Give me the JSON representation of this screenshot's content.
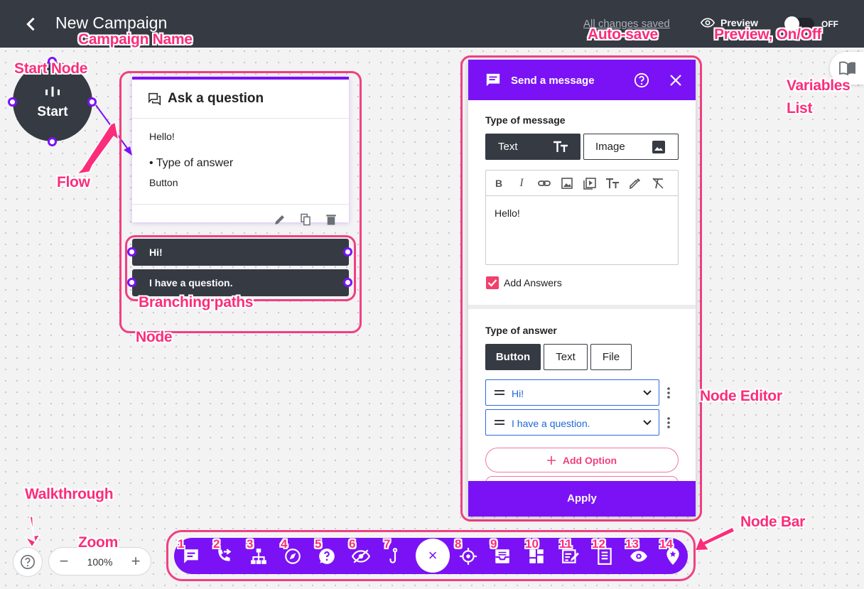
{
  "header": {
    "campaign_name": "New Campaign",
    "autosave_text": "All changes saved",
    "preview_label": "Preview",
    "toggle_state": "OFF"
  },
  "start_node": {
    "label": "Start"
  },
  "question_node": {
    "title": "Ask a question",
    "message": "Hello!",
    "type_of_answer": "• Type of answer",
    "answer_type": "Button",
    "branches": [
      "Hi!",
      "I have a question."
    ]
  },
  "editor": {
    "title": "Send a message",
    "type_of_message_label": "Type of message",
    "message_types": [
      "Text",
      "Image"
    ],
    "message_text": "Hello!",
    "add_answers_label": "Add Answers",
    "type_of_answer_label": "Type of answer",
    "answer_types": [
      "Button",
      "Text",
      "File"
    ],
    "answers": [
      "Hi!",
      "I have a question."
    ],
    "add_option_label": "Add Option",
    "apply_label": "Apply"
  },
  "zoom": {
    "value": "100%",
    "minus": "−",
    "plus": "+"
  },
  "nodebar": {
    "numbers": [
      "1",
      "2",
      "3",
      "4",
      "5",
      "6",
      "7",
      "8",
      "9",
      "10",
      "11",
      "12",
      "13",
      "14"
    ],
    "close_glyph": "×"
  },
  "annotations": {
    "campaign_name": "Campaign Name",
    "auto_save": "Auto-save",
    "preview": "Preview, On/Off",
    "start_node": "Start Node",
    "flow": "Flow",
    "variables_line1": "Variables",
    "variables_line2": "List",
    "branching_paths": "Branching paths",
    "node": "Node",
    "node_editor": "Node Editor",
    "walkthrough": "Walkthrough",
    "zoom": "Zoom",
    "node_bar": "Node Bar"
  },
  "colors": {
    "brand_purple": "#7b12f5",
    "dark": "#353a43",
    "annotation_pink": "#fb2d7b",
    "link_blue": "#1e67d8"
  },
  "icons": [
    "chevron-left-icon",
    "eye-icon",
    "chat-icon",
    "help-circle-icon",
    "close-icon",
    "text-format-icon",
    "image-icon",
    "bold-icon",
    "italic-icon",
    "link-icon",
    "video-icon",
    "text-size-icon",
    "eyedropper-icon",
    "clear-format-icon",
    "drag-handle-icon",
    "chevron-down-icon",
    "more-vert-icon",
    "plus-icon",
    "pencil-icon",
    "copy-icon",
    "trash-icon",
    "book-icon",
    "question-circle-icon"
  ]
}
